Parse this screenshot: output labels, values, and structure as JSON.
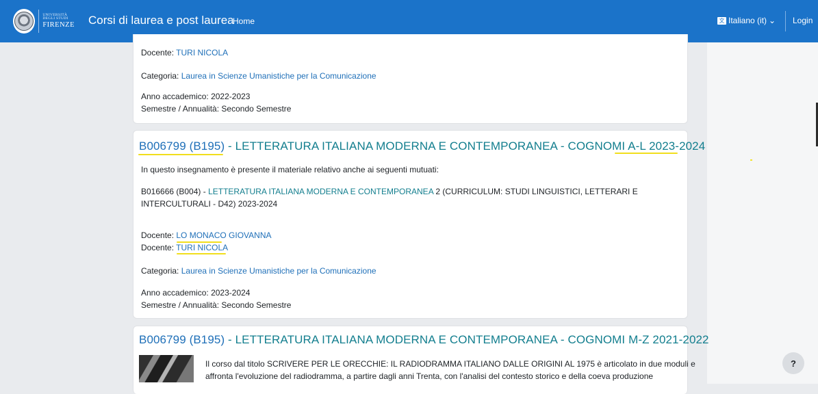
{
  "navbar": {
    "logo_line1": "UNIVERSITÀ",
    "logo_line2": "DEGLI STUDI",
    "logo_line3": "FIRENZE",
    "site_title": "Corsi di laurea e post laurea",
    "home_label": "Home",
    "language_label": "Italiano (it)",
    "language_chevron": "⌄",
    "login_label": "Login"
  },
  "help_label": "?",
  "card1": {
    "docente_label": "Docente:",
    "docente_value": "TURI NICOLA",
    "categoria_label": "Categoria:",
    "categoria_value": "Laurea in Scienze Umanistiche per la Comunicazione",
    "anno_label": "Anno accademico:",
    "anno_value": "2022-2023",
    "semestre_label": "Semestre / Annualità:",
    "semestre_value": "Secondo Semestre"
  },
  "card2": {
    "title_code": "B006799 (B195)",
    "title_rest": " - LETTERATURA ITALIANA MODERNA E CONTEMPORANEA - COGNOMI A-L 2023-2024",
    "intro": "In questo insegnamento è presente il materiale relativo anche ai seguenti mutuati:",
    "mutuato_code": "B016666 (B004) -",
    "mutuato_name": "LETTERATURA ITALIANA MODERNA E CONTEMPORANEA",
    "mutuato_rest1": " 2 (CURRICULUM: STUDI LINGUISTICI, LETTERARI E",
    "mutuato_rest2": "INTERCULTURALI - D42) 2023-2024",
    "docente_label": "Docente:",
    "docente1_value": "LO MONACO GIOVANNA",
    "docente2_value": "TURI NICOLA",
    "categoria_label": "Categoria:",
    "categoria_value": "Laurea in Scienze Umanistiche per la Comunicazione",
    "anno_label": "Anno accademico:",
    "anno_value": "2023-2024",
    "semestre_label": "Semestre / Annualità:",
    "semestre_value": "Secondo Semestre"
  },
  "card3": {
    "title_code": "B006799 (B195)",
    "title_rest": " - LETTERATURA ITALIANA MODERNA E CONTEMPORANEA - COGNOMI M-Z 2021-2022",
    "desc_line1": "Il corso dal titolo SCRIVERE PER LE ORECCHIE: IL RADIODRAMMA ITALIANO DALLE ORIGINI AL 1975 è articolato in due moduli e",
    "desc_line2": "affronta l'evoluzione del radiodramma, a partire dagli anni Trenta, con l'analisi del contesto storico e della coeva produzione"
  }
}
